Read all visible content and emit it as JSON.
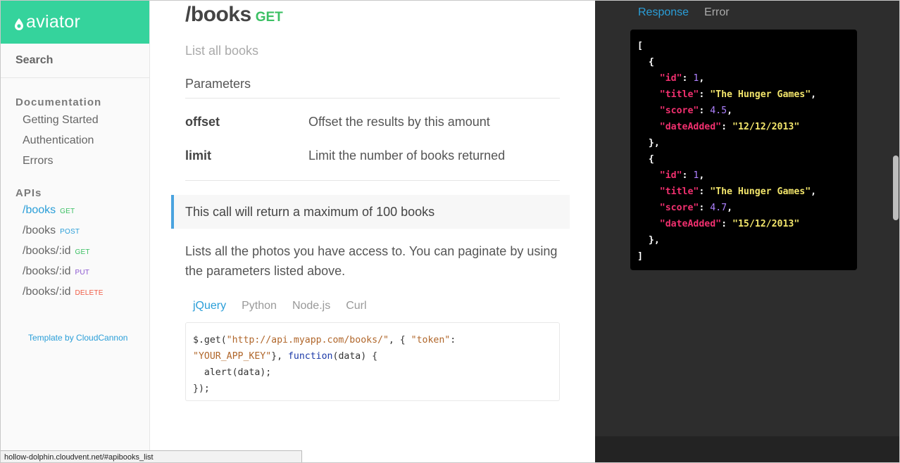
{
  "brand": {
    "name": "aviator"
  },
  "sidebar": {
    "search_label": "Search",
    "documentation_heading": "Documentation",
    "doc_items": [
      {
        "label": "Getting Started"
      },
      {
        "label": "Authentication"
      },
      {
        "label": "Errors"
      }
    ],
    "apis_heading": "APIs",
    "api_items": [
      {
        "label": "/books",
        "method": "GET",
        "active": true
      },
      {
        "label": "/books",
        "method": "POST",
        "active": false
      },
      {
        "label": "/books/:id",
        "method": "GET",
        "active": false
      },
      {
        "label": "/books/:id",
        "method": "PUT",
        "active": false
      },
      {
        "label": "/books/:id",
        "method": "DELETE",
        "active": false
      }
    ],
    "credit": "Template by CloudCannon"
  },
  "main": {
    "title": "/books",
    "verb": "GET",
    "description": "List all books",
    "parameters_heading": "Parameters",
    "parameters": [
      {
        "name": "offset",
        "description": "Offset the results by this amount"
      },
      {
        "name": "limit",
        "description": "Limit the number of books returned"
      }
    ],
    "callout": "This call will return a maximum of 100 books",
    "paragraph": "Lists all the photos you have access to. You can paginate by using the parameters listed above.",
    "code_tabs": [
      {
        "label": "jQuery",
        "active": true
      },
      {
        "label": "Python",
        "active": false
      },
      {
        "label": "Node.js",
        "active": false
      },
      {
        "label": "Curl",
        "active": false
      }
    ],
    "code": {
      "l1_a": "$.get(",
      "l1_url": "\"http://api.myapp.com/books/\"",
      "l1_b": ", { ",
      "l1_token": "\"token\"",
      "l1_c": ":",
      "l2_key": "\"YOUR_APP_KEY\"",
      "l2_a": "}, ",
      "l2_fn": "function",
      "l2_b": "(data) {",
      "l3": "  alert(data);",
      "l4": "});"
    }
  },
  "response_panel": {
    "tabs": [
      {
        "label": "Response",
        "active": true
      },
      {
        "label": "Error",
        "active": false
      }
    ],
    "items": [
      {
        "id": "1",
        "title": "\"The Hunger Games\"",
        "score": "4.5",
        "dateAdded": "\"12/12/2013\""
      },
      {
        "id": "1",
        "title": "\"The Hunger Games\"",
        "score": "4.7",
        "dateAdded": "\"15/12/2013\""
      }
    ],
    "keys": {
      "id": "\"id\"",
      "title": "\"title\"",
      "score": "\"score\"",
      "dateAdded": "\"dateAdded\""
    }
  },
  "status_bar": {
    "url": "hollow-dolphin.cloudvent.net/#apibooks_list"
  },
  "colors": {
    "brand": "#35d39c",
    "accent": "#2a9ed8",
    "get": "#3cc064",
    "post": "#2a9ed8",
    "put": "#8a55d0",
    "delete": "#ef5a43",
    "panel_bg": "#2d2d2d"
  }
}
